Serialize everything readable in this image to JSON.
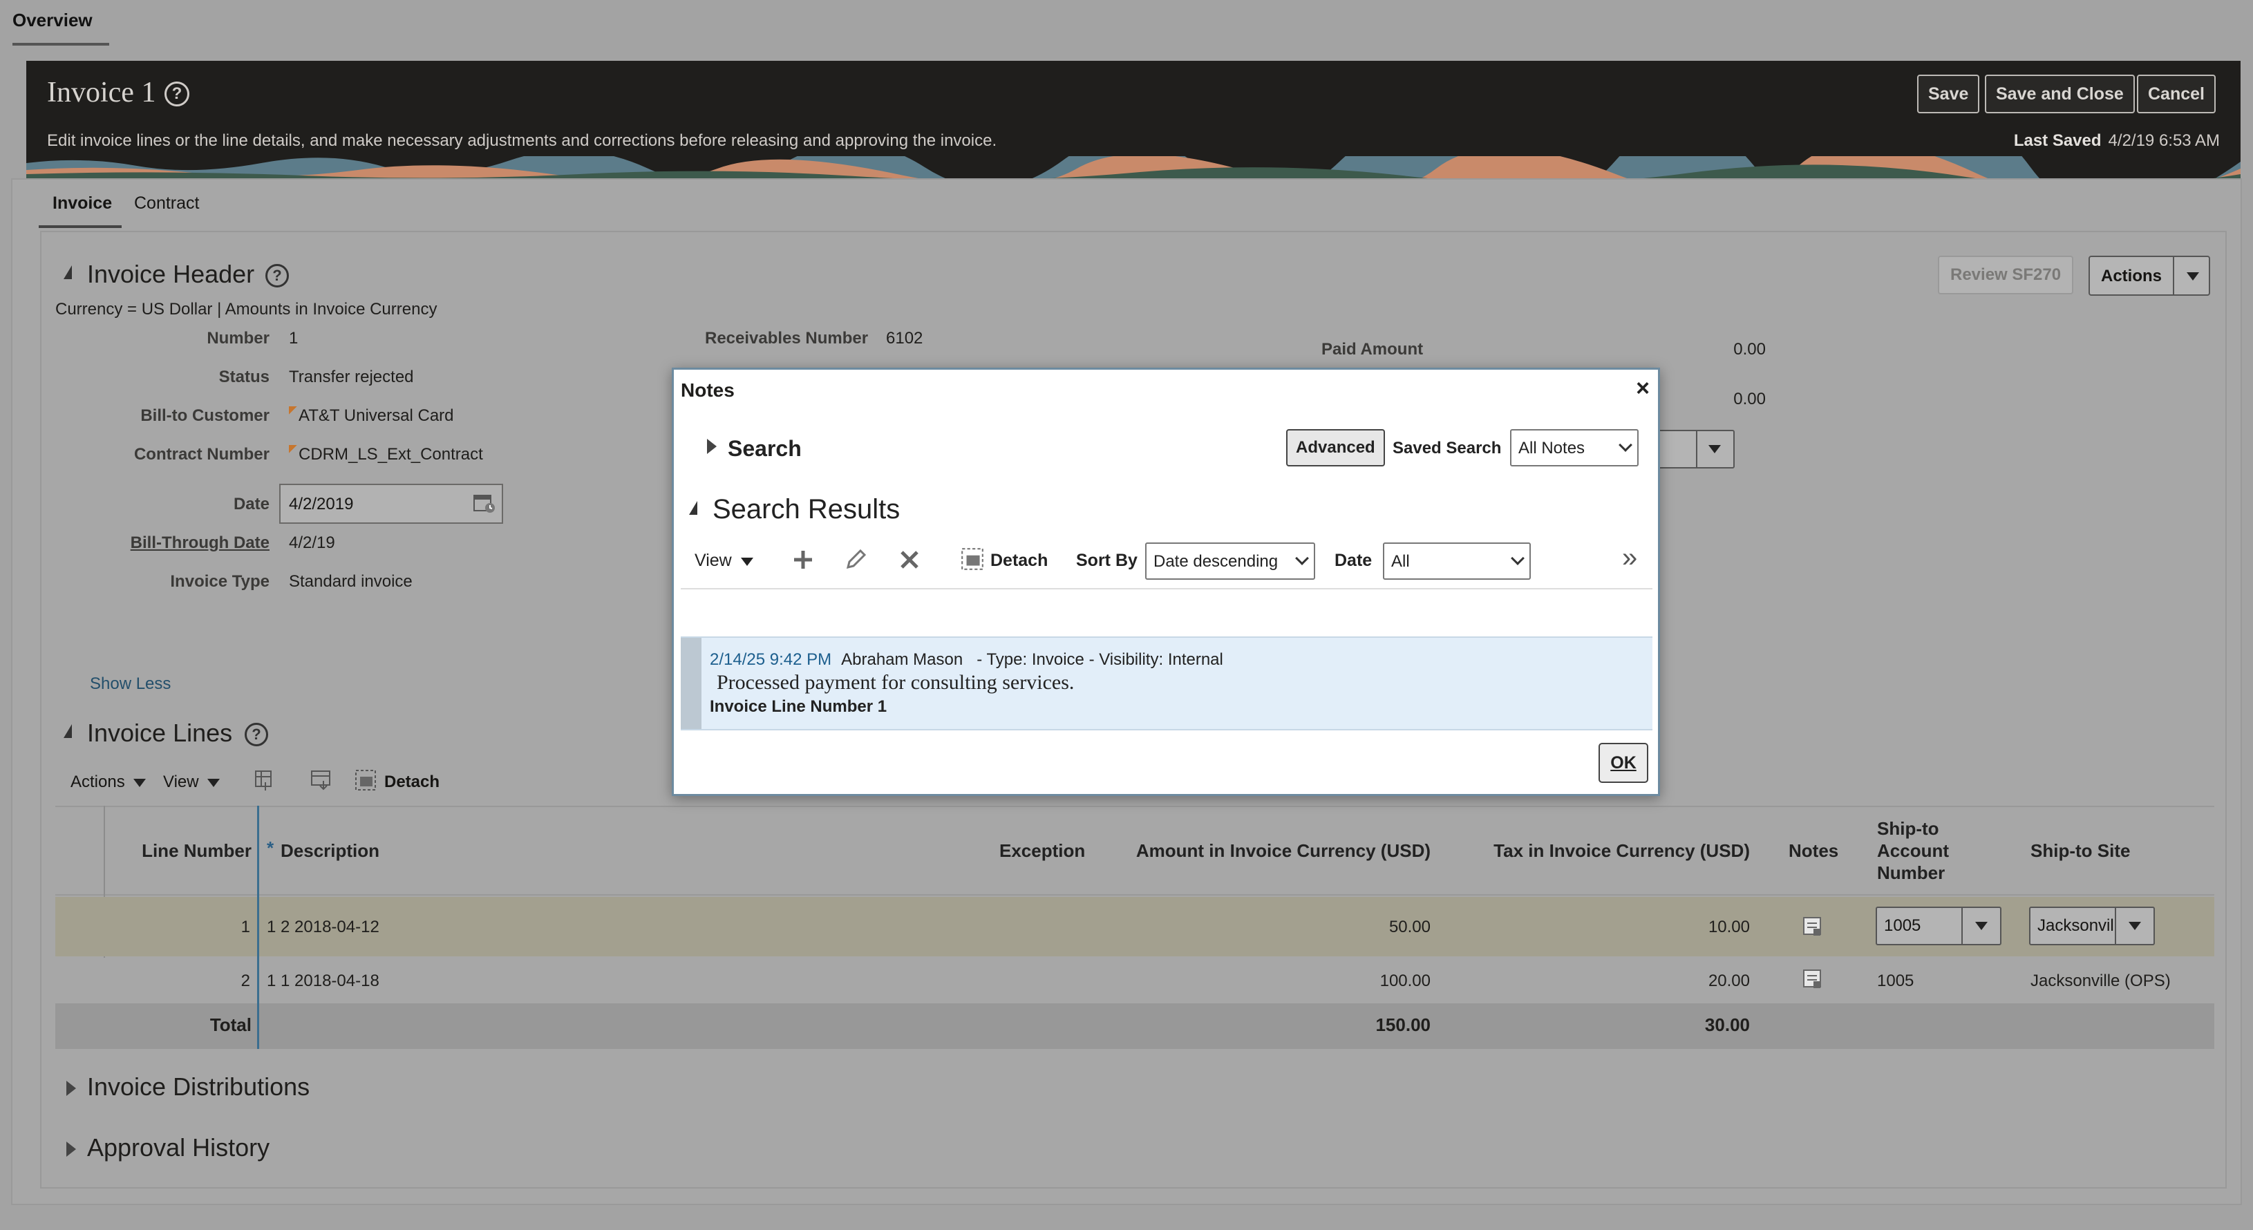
{
  "top_tabs": {
    "overview": "Overview"
  },
  "header": {
    "title": "Invoice 1",
    "help_glyph": "?",
    "subtitle": "Edit invoice lines or the line details, and make necessary adjustments and corrections before releasing and approving the invoice.",
    "last_saved_label": "Last Saved",
    "last_saved_value": "4/2/19 6:53 AM",
    "save_label": "Save",
    "save_close_label": "Save and Close",
    "cancel_label": "Cancel"
  },
  "sub_tabs": {
    "invoice": "Invoice",
    "contract": "Contract"
  },
  "invoice_header": {
    "title": "Invoice Header",
    "currency_line": "Currency = US Dollar | Amounts in Invoice Currency",
    "review_label": "Review SF270",
    "actions_label": "Actions",
    "fields": {
      "number_label": "Number",
      "number_value": "1",
      "status_label": "Status",
      "status_value": "Transfer rejected",
      "bill_to_label": "Bill-to Customer",
      "bill_to_value": "AT&T Universal Card",
      "contract_label": "Contract Number",
      "contract_value": "CDRM_LS_Ext_Contract",
      "date_label": "Date",
      "date_value": "4/2/2019",
      "bill_through_label": "Bill-Through Date",
      "bill_through_value": "4/2/19",
      "invoice_type_label": "Invoice Type",
      "invoice_type_value": "Standard invoice",
      "receivables_label": "Receivables Number",
      "receivables_value": "6102",
      "paid_amount_label": "Paid Amount",
      "paid_amount_value": "0.00",
      "second_amount_value": "0.00"
    },
    "show_less": "Show Less"
  },
  "invoice_lines": {
    "title": "Invoice Lines",
    "toolbar": {
      "actions": "Actions",
      "view": "View",
      "detach": "Detach"
    },
    "columns": {
      "line_number": "Line Number",
      "required_mark": "*",
      "description": "Description",
      "exception": "Exception",
      "amount": "Amount in Invoice Currency (USD)",
      "tax": "Tax in Invoice Currency (USD)",
      "notes": "Notes",
      "ship_to_account_1": "Ship-to",
      "ship_to_account_2": "Account",
      "ship_to_account_3": "Number",
      "ship_to_site": "Ship-to Site"
    },
    "rows": [
      {
        "line": "1",
        "description": "1 2 2018-04-12",
        "amount": "50.00",
        "tax": "10.00",
        "account": "1005",
        "site": "Jacksonvil"
      },
      {
        "line": "2",
        "description": "1 1 2018-04-18",
        "amount": "100.00",
        "tax": "20.00",
        "account": "1005",
        "site": "Jacksonville (OPS)"
      }
    ],
    "total": {
      "label": "Total",
      "amount": "150.00",
      "tax": "30.00"
    }
  },
  "collapsed_sections": {
    "distributions": "Invoice Distributions",
    "approval": "Approval History"
  },
  "dialog": {
    "title": "Notes",
    "close_glyph": "×",
    "search_label": "Search",
    "advanced_label": "Advanced",
    "saved_search_label": "Saved Search",
    "saved_search_value": "All Notes",
    "results_label": "Search Results",
    "view_label": "View",
    "detach_label": "Detach",
    "sort_by_label": "Sort By",
    "sort_by_value": "Date descending",
    "date_label": "Date",
    "date_value": "All",
    "more_glyph": "»",
    "note": {
      "timestamp": "2/14/25 9:42 PM",
      "author": "Abraham Mason",
      "type_label": "- Type:",
      "type_value": "Invoice",
      "visibility_label": "- Visibility:",
      "visibility_value": "Internal",
      "text": "Processed payment for consulting services.",
      "line_ref": "Invoice Line Number 1"
    },
    "ok_label": "OK"
  }
}
